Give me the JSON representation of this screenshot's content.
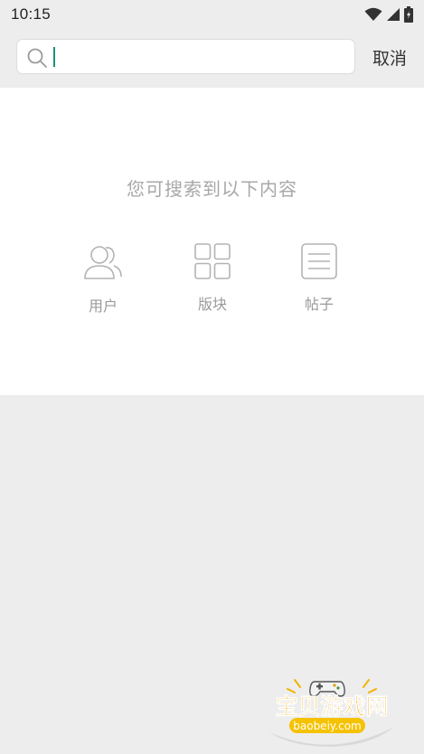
{
  "status_bar": {
    "time": "10:15",
    "icons": [
      "wifi-icon",
      "signal-icon",
      "battery-icon"
    ]
  },
  "search": {
    "placeholder": "",
    "value": "",
    "cancel_label": "取消"
  },
  "content": {
    "hint": "您可搜索到以下内容",
    "categories": [
      {
        "label": "用户",
        "icon": "user-icon"
      },
      {
        "label": "版块",
        "icon": "grid-icon"
      },
      {
        "label": "帖子",
        "icon": "post-icon"
      }
    ]
  },
  "watermark": {
    "brand": "宝贝游戏网",
    "domain": "baobeiy.com"
  },
  "colors": {
    "background": "#ededed",
    "card": "#ffffff",
    "caret": "#1a8f7a",
    "muted_text": "#a8a8a8"
  }
}
